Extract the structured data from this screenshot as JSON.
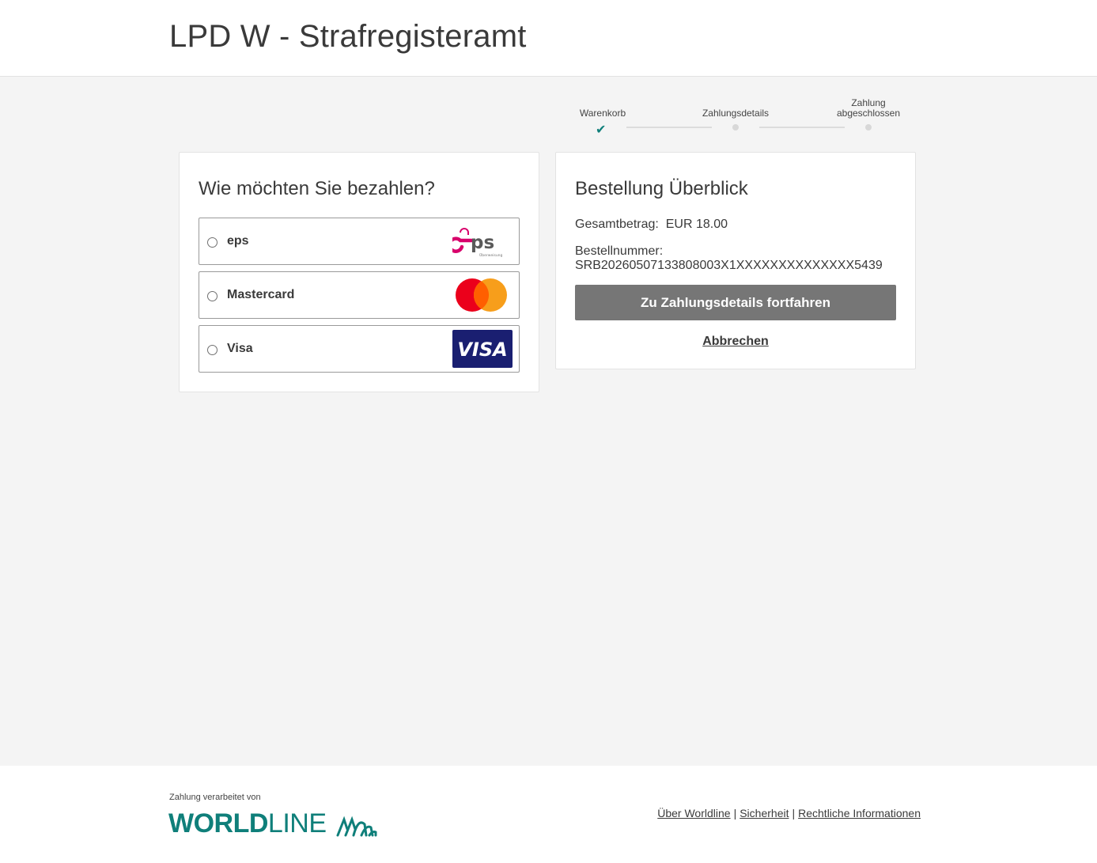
{
  "header": {
    "title": "LPD W - Strafregisteramt"
  },
  "stepper": {
    "steps": [
      {
        "label": "Warenkorb",
        "label2": "",
        "state": "done"
      },
      {
        "label": "Zahlungsdetails",
        "label2": "",
        "state": "pending"
      },
      {
        "label": "Zahlung",
        "label2": "abgeschlossen",
        "state": "pending"
      }
    ],
    "check_glyph": "✔"
  },
  "payment": {
    "heading": "Wie möchten Sie bezahlen?",
    "options": [
      {
        "label": "eps",
        "icon": "eps-logo-icon",
        "logo_subtext": "Überweisung"
      },
      {
        "label": "Mastercard",
        "icon": "mastercard-logo-icon"
      },
      {
        "label": "Visa",
        "icon": "visa-logo-icon",
        "logo_text": "VISA"
      }
    ]
  },
  "summary": {
    "heading": "Bestellung Überblick",
    "total_label": "Gesamtbetrag:",
    "total_value": "EUR 18.00",
    "order_label": "Bestellnummer:",
    "order_value": "SRB20260507133808003X1XXXXXXXXXXXXXX5439",
    "continue_button": "Zu Zahlungsdetails fortfahren",
    "cancel_link": "Abbrechen"
  },
  "footer": {
    "processed_by": "Zahlung verarbeitet von",
    "brand_bold": "WORLD",
    "brand_light": "LINE",
    "links": [
      "Über Worldline",
      "Sicherheit",
      "Rechtliche Informationen"
    ]
  },
  "colors": {
    "accent": "#0f7f7a",
    "button": "#767676",
    "background": "#f4f4f4",
    "eps_pink": "#d8006b",
    "visa_blue": "#1a1f71",
    "mc_red": "#eb001b",
    "mc_orange": "#f79e1b"
  }
}
